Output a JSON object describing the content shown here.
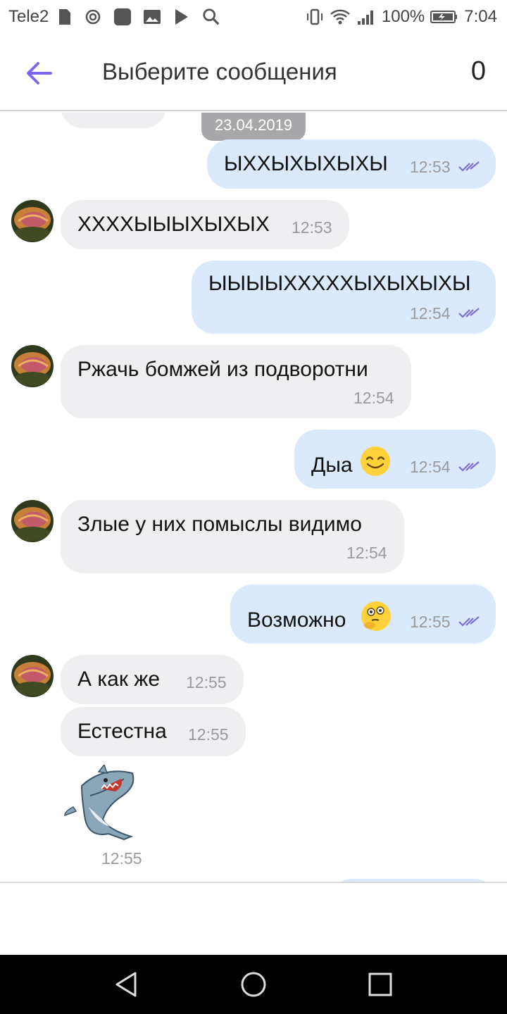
{
  "status_bar": {
    "carrier": "Tele2",
    "battery": "100%",
    "time": "7:04"
  },
  "header": {
    "title": "Выберите сообщения",
    "selected_count": "0"
  },
  "date_chip": "23.04.2019",
  "messages": [
    {
      "direction": "out",
      "text": "ЫХХЫХЫХЫХЫ",
      "time": "12:53"
    },
    {
      "direction": "in",
      "text": "ХХХХЫЫЫХЫХЫХ",
      "time": "12:53"
    },
    {
      "direction": "out",
      "text": "ЫЫЫЫХХХХХЫХЫХЫХЫ",
      "time": "12:54"
    },
    {
      "direction": "in",
      "text": "Ржачь бомжей из подворотни",
      "time": "12:54"
    },
    {
      "direction": "out",
      "text": "Дыа",
      "emoji": "smiling-face-emoji",
      "time": "12:54"
    },
    {
      "direction": "in",
      "text": "Злые у них помыслы видимо",
      "time": "12:54"
    },
    {
      "direction": "out",
      "text": "Возможно",
      "emoji": "thinking-face-emoji",
      "time": "12:55"
    },
    {
      "direction": "in",
      "text": "А как же",
      "time": "12:55"
    },
    {
      "direction": "in",
      "text": "Естестна",
      "time": "12:55"
    },
    {
      "direction": "in",
      "sticker": "shark-sticker",
      "time": "12:55"
    }
  ],
  "colors": {
    "accent": "#7b68ee",
    "incoming_bubble": "#efeef0",
    "outgoing_bubble": "#dbe9fc",
    "time_text": "#9a9a9e",
    "read_ticks": "#7b6fd6"
  }
}
